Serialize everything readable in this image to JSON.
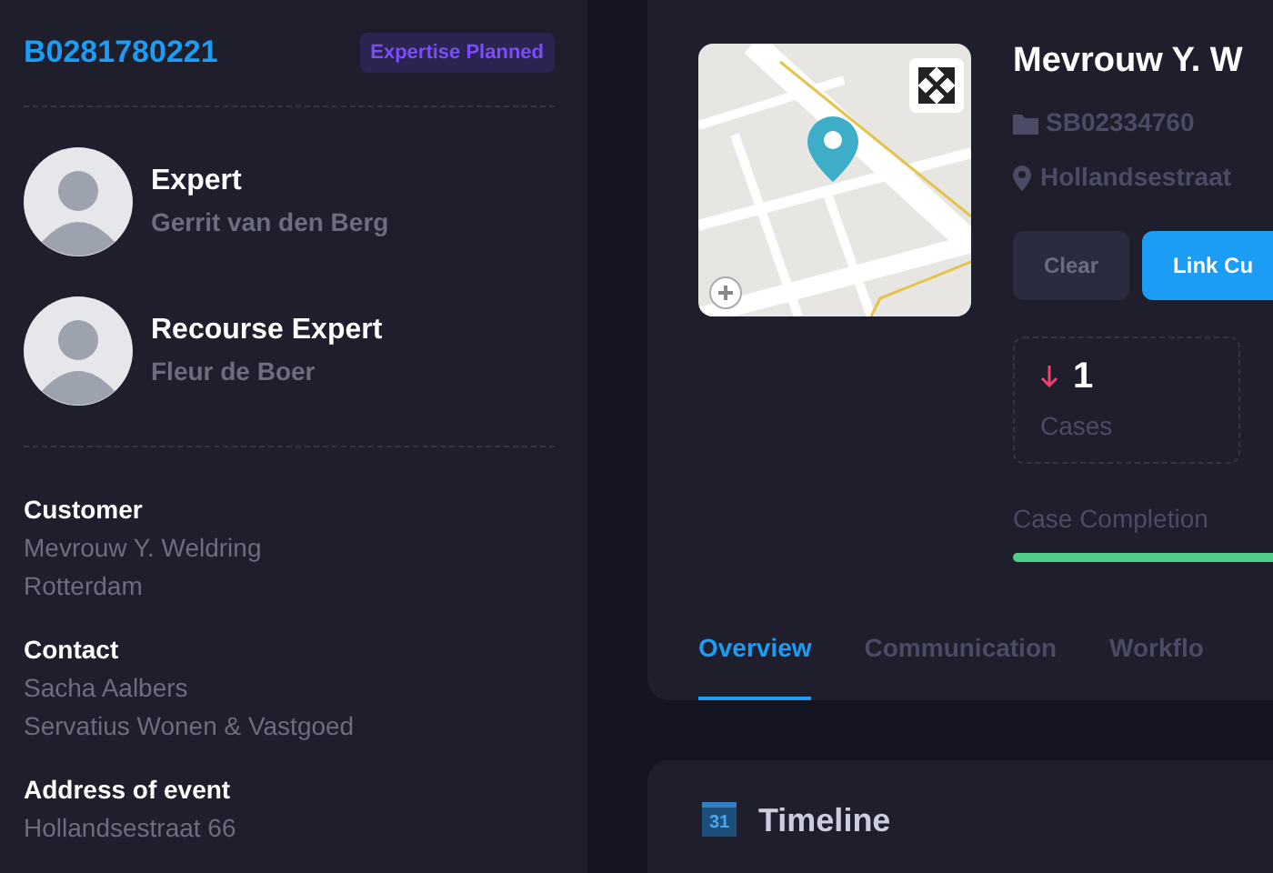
{
  "sidebar": {
    "case_number": "B0281780221",
    "status_badge": "Expertise Planned",
    "people": [
      {
        "role": "Expert",
        "name": "Gerrit van den Berg"
      },
      {
        "role": "Recourse Expert",
        "name": "Fleur de Boer"
      }
    ],
    "details": [
      {
        "label": "Customer",
        "lines": [
          "Mevrouw Y. Weldring",
          "Rotterdam"
        ]
      },
      {
        "label": "Contact",
        "lines": [
          "Sacha Aalbers",
          "Servatius Wonen & Vastgoed"
        ]
      },
      {
        "label": "Address of event",
        "lines": [
          "Hollandsestraat 66"
        ]
      }
    ]
  },
  "header": {
    "title": "Mevrouw Y. W",
    "reference": "SB02334760",
    "address": "Hollandsestraat",
    "buttons": [
      {
        "label": "Clear",
        "kind": "secondary"
      },
      {
        "label": "Link Cu",
        "kind": "primary"
      }
    ],
    "stat": {
      "value": "1",
      "label": "Cases"
    },
    "progress": {
      "label": "Case Completion",
      "level": 1
    },
    "tabs": [
      {
        "label": "Overview",
        "selected": true
      },
      {
        "label": "Communication",
        "selected": false
      },
      {
        "label": "Workflo",
        "selected": false
      }
    ]
  },
  "timeline": {
    "calendar_day": "31",
    "title": "Timeline"
  }
}
